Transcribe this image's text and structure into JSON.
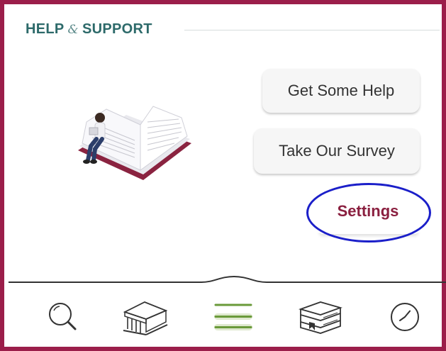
{
  "header": {
    "title_part1": "HELP",
    "ampersand": "&",
    "title_part2": "SUPPORT"
  },
  "buttons": {
    "help_label": "Get Some Help",
    "survey_label": "Take Our Survey",
    "settings_label": "Settings"
  },
  "colors": {
    "frame_border": "#9b1e4a",
    "header_text": "#2d6a6a",
    "settings_text": "#8a1f3f",
    "highlight_ring": "#1b1fc9",
    "active_nav": "#6a9a3a"
  },
  "nav": {
    "items": [
      {
        "icon": "search-icon"
      },
      {
        "icon": "library-icon"
      },
      {
        "icon": "menu-icon",
        "active": true
      },
      {
        "icon": "books-icon"
      },
      {
        "icon": "clock-icon"
      }
    ]
  }
}
